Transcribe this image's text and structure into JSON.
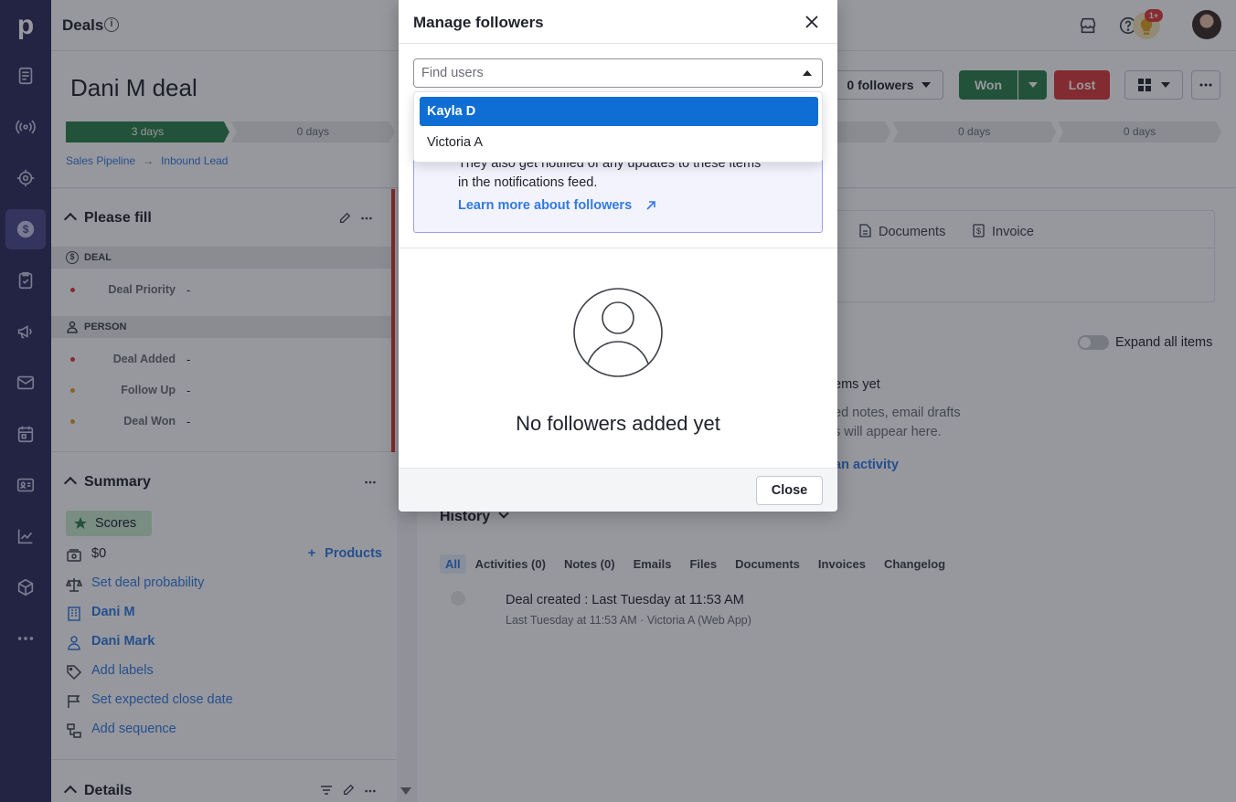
{
  "app": {
    "logo_letter": "p",
    "page_title": "Deals"
  },
  "topbar": {
    "notification_badge": "1+"
  },
  "deal": {
    "title": "Dani M deal",
    "followers_button": "0 followers",
    "won_label": "Won",
    "lost_label": "Lost",
    "stages": [
      {
        "label": "3 days",
        "done": true
      },
      {
        "label": "0 days",
        "done": false
      },
      {
        "label": "",
        "done": false
      },
      {
        "label": "",
        "done": false
      },
      {
        "label": "",
        "done": false
      },
      {
        "label": "0 days",
        "done": false
      },
      {
        "label": "0 days",
        "done": false
      }
    ],
    "pipeline": "Sales Pipeline",
    "stage_name": "Inbound Lead",
    "path_arrow": "→"
  },
  "sidebar": {
    "please_fill": {
      "heading": "Please fill",
      "deal_group": "DEAL",
      "person_group": "PERSON",
      "fields": [
        {
          "label": "Deal Priority",
          "value": "-",
          "dot": "#d93a3a"
        },
        {
          "label": "Deal Added",
          "value": "-",
          "dot": "#d93a3a"
        },
        {
          "label": "Follow Up",
          "value": "-",
          "dot": "#e0a020"
        },
        {
          "label": "Deal Won",
          "value": "-",
          "dot": "#e0a020"
        }
      ]
    },
    "summary": {
      "heading": "Summary",
      "scores": "Scores",
      "amount": "$0",
      "products": "Products",
      "probability": "Set deal probability",
      "org": "Dani M",
      "person": "Dani Mark",
      "labels": "Add labels",
      "close_date": "Set expected close date",
      "sequence": "Add sequence"
    },
    "details": {
      "heading": "Details"
    }
  },
  "main": {
    "tabs": {
      "documents": "Documents",
      "invoice": "Invoice"
    },
    "expand_all": "Expand all items",
    "focus_partial_1": "ems yet",
    "focus_partial_2": "ed notes, email drafts",
    "focus_partial_3": "s will appear here.",
    "focus_partial_link": "an activity",
    "history": {
      "heading": "History",
      "tabs": [
        "All",
        "Activities (0)",
        "Notes (0)",
        "Emails",
        "Files",
        "Documents",
        "Invoices",
        "Changelog"
      ],
      "entry_title": "Deal created : Last Tuesday at 11:53 AM",
      "entry_meta": "Last Tuesday at 11:53 AM · Victoria A (Web App)"
    }
  },
  "modal": {
    "title": "Manage followers",
    "search_placeholder": "Find users",
    "info_line1": "They also get notified of any updates to these items",
    "info_line2": "in the notifications feed.",
    "info_link": "Learn more about followers",
    "empty_text": "No followers added yet",
    "close_button": "Close",
    "options": [
      "Kayla D",
      "Victoria A"
    ]
  },
  "colors": {
    "rail": "#2c2d5c",
    "primary_green": "#2a8049",
    "lost_red": "#d93a3a",
    "link_blue": "#317ae2",
    "selected_option": "#0f6ed4"
  }
}
